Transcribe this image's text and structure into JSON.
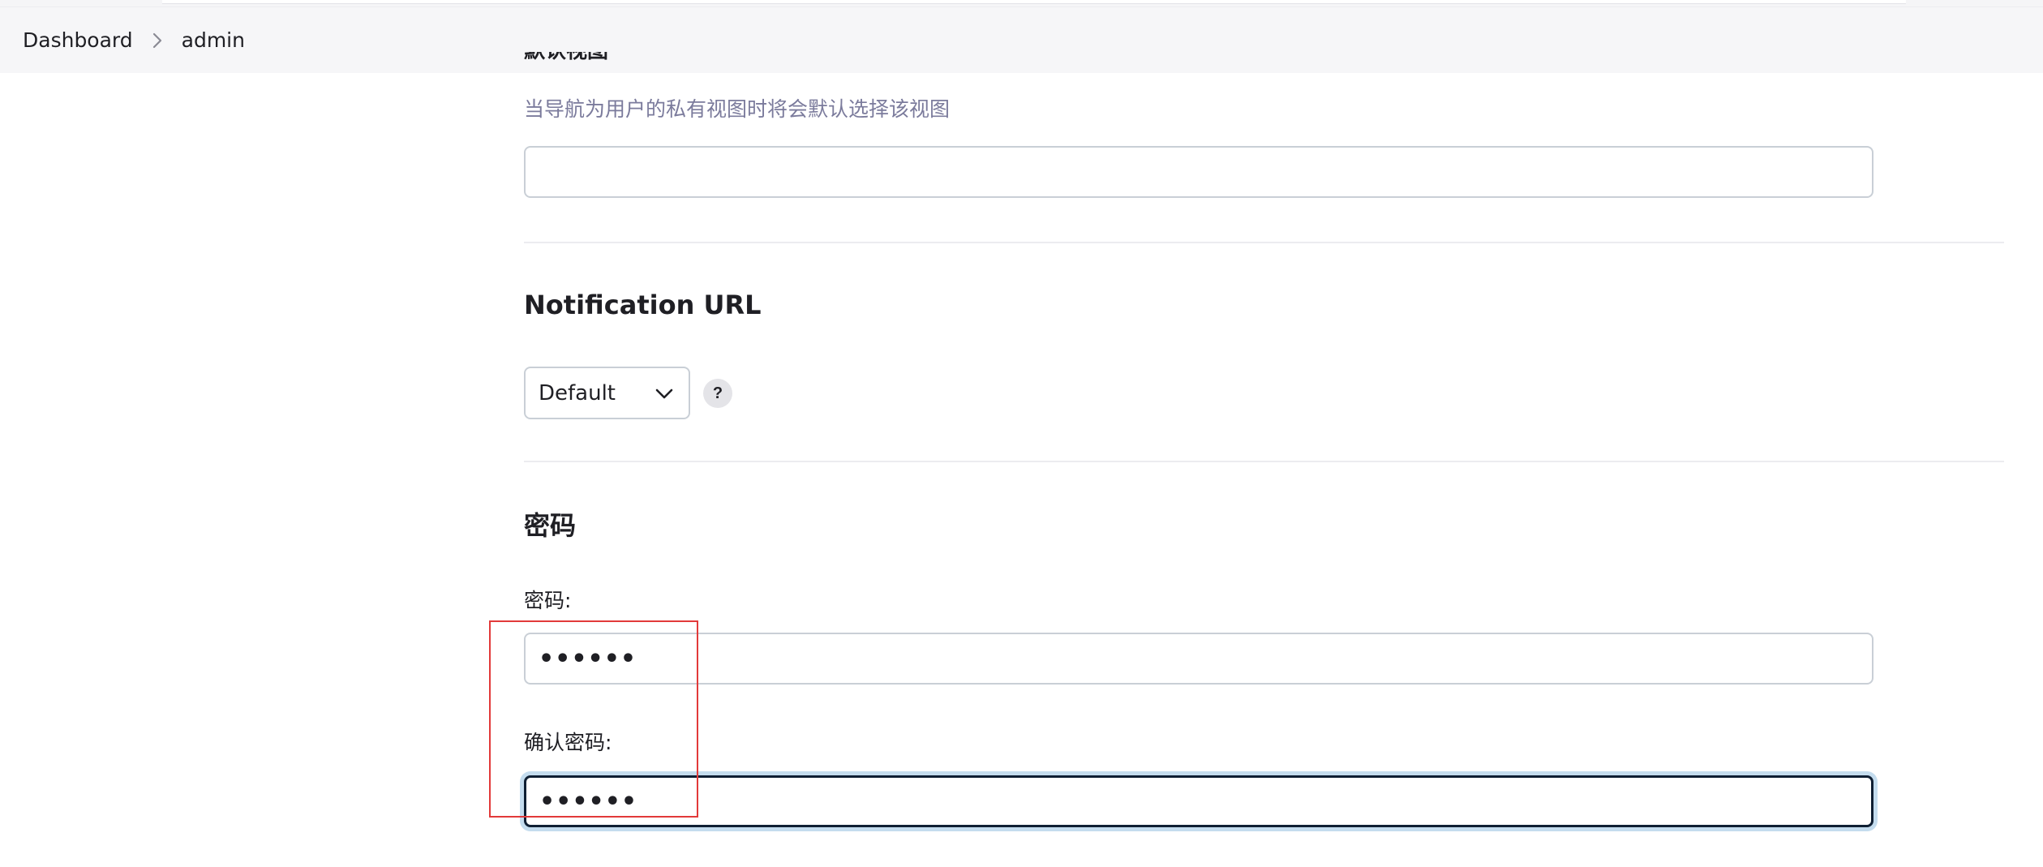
{
  "breadcrumb": {
    "items": [
      {
        "label": "Dashboard"
      },
      {
        "label": "admin"
      }
    ],
    "separator_icon": "chevron-right-icon"
  },
  "default_view": {
    "heading": "默认视图",
    "help_text": "当导航为用户的私有视图时将会默认选择该视图",
    "value": ""
  },
  "notification_url": {
    "title": "Notification URL",
    "select_value": "Default",
    "help_label": "?"
  },
  "password_section": {
    "title": "密码",
    "password_label": "密码:",
    "password_value": "••••••",
    "confirm_label": "确认密码:",
    "confirm_value": "••••••"
  },
  "colors": {
    "help_text": "#7b7b9c",
    "annotation": "#e23a3a",
    "focus_ring": "#c4dcee",
    "focus_border": "#0f1f33"
  }
}
